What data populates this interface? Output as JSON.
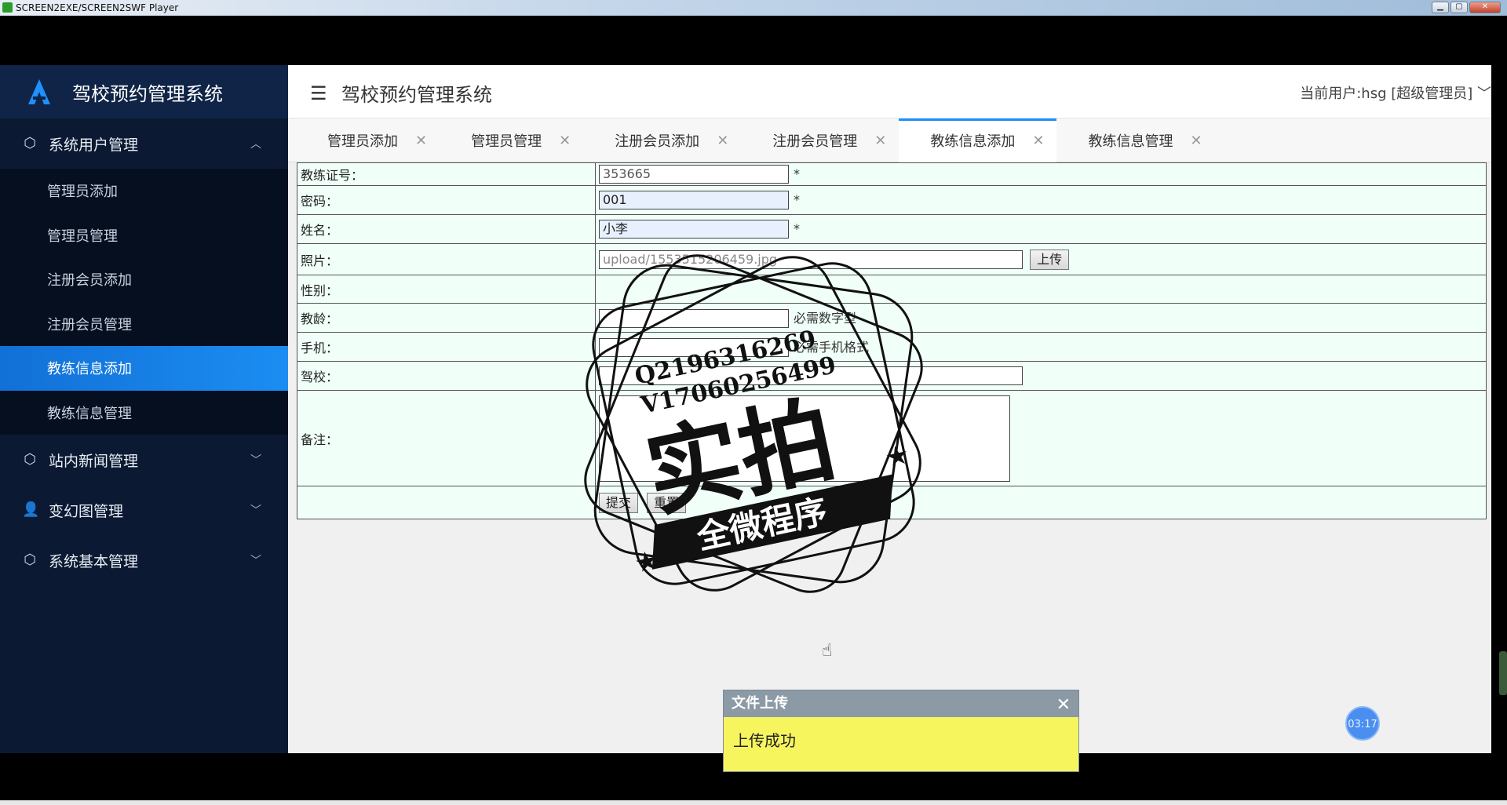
{
  "player": {
    "title": "SCREEN2EXE/SCREEN2SWF Player"
  },
  "brand": {
    "title": "驾校预约管理系统"
  },
  "header": {
    "title": "驾校预约管理系统",
    "user": "当前用户:hsg [超级管理员]"
  },
  "sidebar": {
    "groups": [
      {
        "label": "系统用户管理",
        "icon": "cube-icon",
        "expanded": true
      },
      {
        "label": "站内新闻管理",
        "icon": "cube-icon",
        "expanded": false
      },
      {
        "label": "变幻图管理",
        "icon": "user-icon",
        "expanded": false
      },
      {
        "label": "系统基本管理",
        "icon": "cube-icon",
        "expanded": false
      }
    ],
    "items": [
      {
        "label": "管理员添加"
      },
      {
        "label": "管理员管理"
      },
      {
        "label": "注册会员添加"
      },
      {
        "label": "注册会员管理"
      },
      {
        "label": "教练信息添加"
      },
      {
        "label": "教练信息管理"
      }
    ]
  },
  "tabs": [
    {
      "label": "管理员添加"
    },
    {
      "label": "管理员管理"
    },
    {
      "label": "注册会员添加"
    },
    {
      "label": "注册会员管理"
    },
    {
      "label": "教练信息添加"
    },
    {
      "label": "教练信息管理"
    }
  ],
  "form": {
    "coach_id_label": "教练证号：",
    "coach_id_value": "353665",
    "password_label": "密码：",
    "password_value": "001",
    "name_label": "姓名：",
    "name_value": "小李",
    "photo_label": "照片：",
    "photo_value": "upload/1553515206459.jpg",
    "upload_button": "上传",
    "gender_label": "性别：",
    "experience_label": "教龄：",
    "experience_hint": "必需数字型",
    "phone_label": "手机：",
    "phone_hint": "必需手机格式",
    "school_label": "驾校：",
    "remarks_label": "备注：",
    "submit_button": "提交",
    "reset_button": "重置",
    "required_mark": "*"
  },
  "watermark": {
    "line1": "Q2196316269",
    "line2": "V17060256499",
    "big": "实拍",
    "ribbon": "全微程序"
  },
  "toast": {
    "title": "文件上传",
    "message": "上传成功"
  },
  "timer": {
    "value": "03:17"
  }
}
